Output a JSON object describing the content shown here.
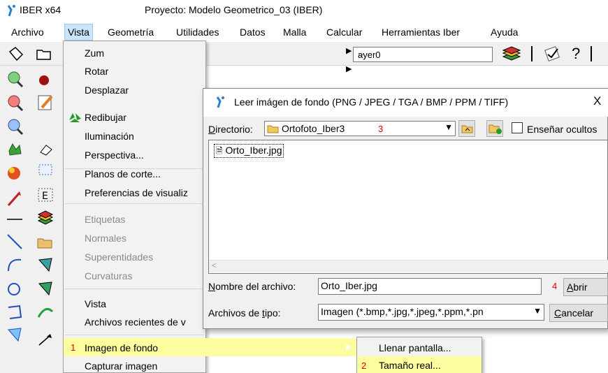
{
  "window": {
    "app_title": "IBER x64",
    "project_title": "Proyecto: Modelo Geometrico_03 (IBER)"
  },
  "menubar": [
    "Archivo",
    "Vista",
    "Geometría",
    "Utilidades",
    "Datos",
    "Malla",
    "Calcular",
    "Herramientas Iber",
    "Ayuda"
  ],
  "toolbar": {
    "layer_value": "ayer0"
  },
  "vista_menu": {
    "items": {
      "zum": "Zum",
      "rotar": "Rotar",
      "desplazar": "Desplazar",
      "redibujar": "Redibujar",
      "iluminacion": "Iluminación",
      "perspectiva": "Perspectiva...",
      "planos_de_corte": "Planos de corte...",
      "preferencias": "Preferencias de visualiz",
      "etiquetas": "Etiquetas",
      "normales": "Normales",
      "superentidades": "Superentidades",
      "curvaturas": "Curvaturas",
      "vista": "Vista",
      "archivos_recientes": "Archivos recientes de v",
      "imagen_de_fondo": "Imagen de fondo",
      "capturar_imagen": "Capturar imagen"
    },
    "step_1": "1"
  },
  "submenu": {
    "llenar_pantalla": "Llenar pantalla...",
    "tamano_real": "Tamaño real...",
    "step_2": "2"
  },
  "dialog": {
    "title": "Leer imágen de fondo (PNG / JPEG / TGA / BMP / PPM / TIFF)",
    "close": "X",
    "directorio_label": "irectorio:",
    "directorio_label_accel": "D",
    "directorio_value": "Ortofoto_Iber3",
    "step_3": "3",
    "show_hidden_label": "Enseñar ocultos",
    "files": [
      "Orto_Iber.jpg"
    ],
    "filename_label": "ombre del archivo:",
    "filename_label_accel": "N",
    "filename_value": "Orto_Iber.jpg",
    "step_4": "4",
    "abrir_accel": "A",
    "abrir_rest": "brir",
    "filetype_label_pre": "Archivos de ",
    "filetype_label_accel": "t",
    "filetype_label_post": "ipo:",
    "filetype_value": "Imagen (*.bmp,*.jpg,*.jpeg,*.ppm,*.pn",
    "cancelar_accel": "C",
    "cancelar_rest": "ancelar"
  }
}
